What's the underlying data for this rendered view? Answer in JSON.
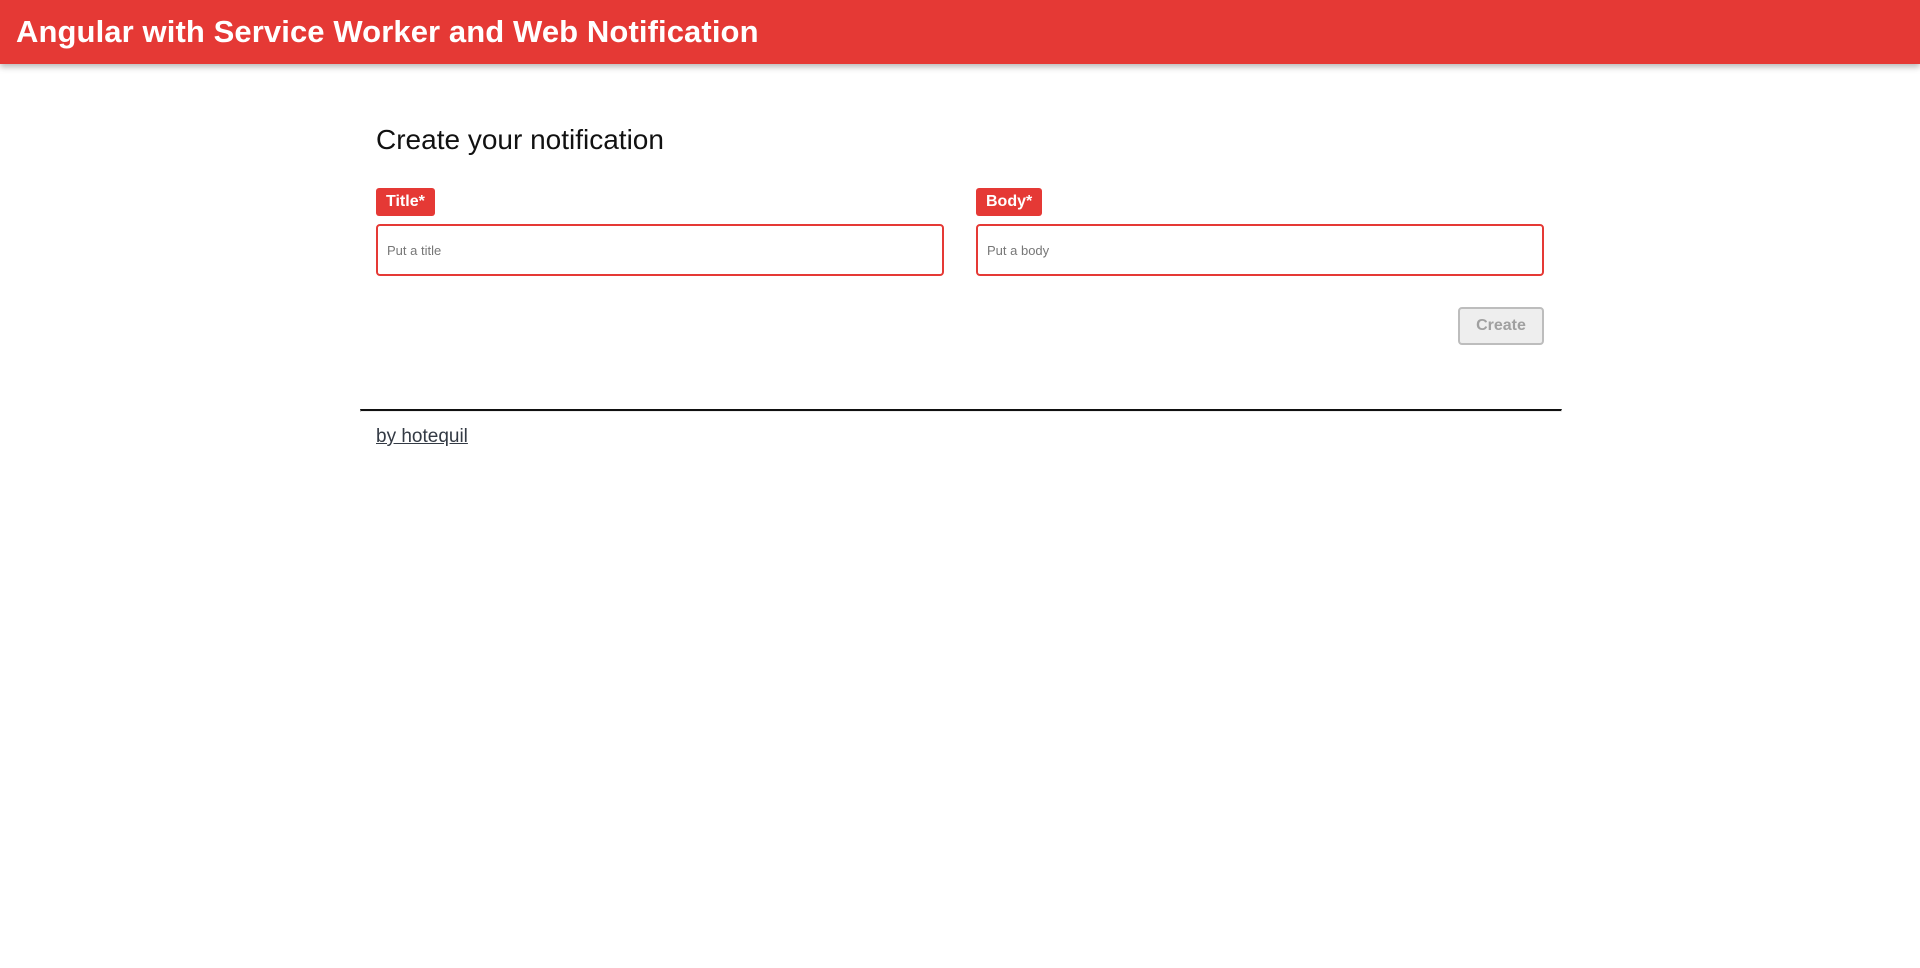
{
  "header": {
    "title": "Angular with Service Worker and Web Notification",
    "color": "#e53935"
  },
  "form": {
    "heading": "Create your notification",
    "title_field": {
      "label": "Title*",
      "placeholder": "Put a title",
      "value": ""
    },
    "body_field": {
      "label": "Body*",
      "placeholder": "Put a body",
      "value": ""
    },
    "create_button": {
      "label": "Create",
      "disabled": true
    }
  },
  "footer": {
    "link_text": "by hotequil"
  }
}
